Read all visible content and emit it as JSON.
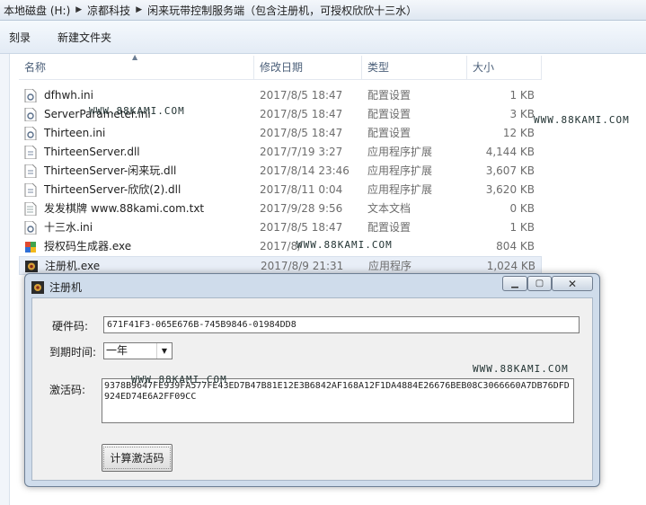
{
  "address_bar": {
    "crumbs": [
      "本地磁盘 (H:)",
      "凉都科技",
      "闲来玩带控制服务端（包含注册机，可授权欣欣十三水）"
    ]
  },
  "toolbar": {
    "burn_label": "刻录",
    "new_folder_label": "新建文件夹"
  },
  "columns": {
    "name": "名称",
    "date": "修改日期",
    "type": "类型",
    "size": "大小"
  },
  "files": [
    {
      "name": "dfhwh.ini",
      "date": "2017/8/5 18:47",
      "type": "配置设置",
      "size": "1 KB",
      "icon": "ini-file-icon"
    },
    {
      "name": "ServerParameter.ini",
      "date": "2017/8/5 18:47",
      "type": "配置设置",
      "size": "3 KB",
      "icon": "ini-file-icon"
    },
    {
      "name": "Thirteen.ini",
      "date": "2017/8/5 18:47",
      "type": "配置设置",
      "size": "12 KB",
      "icon": "ini-file-icon"
    },
    {
      "name": "ThirteenServer.dll",
      "date": "2017/7/19 3:27",
      "type": "应用程序扩展",
      "size": "4,144 KB",
      "icon": "dll-file-icon"
    },
    {
      "name": "ThirteenServer-闲来玩.dll",
      "date": "2017/8/14 23:46",
      "type": "应用程序扩展",
      "size": "3,607 KB",
      "icon": "dll-file-icon"
    },
    {
      "name": "ThirteenServer-欣欣(2).dll",
      "date": "2017/8/11 0:04",
      "type": "应用程序扩展",
      "size": "3,620 KB",
      "icon": "dll-file-icon"
    },
    {
      "name": "发发棋牌 www.88kami.com.txt",
      "date": "2017/9/28 9:56",
      "type": "文本文档",
      "size": "0 KB",
      "icon": "txt-file-icon"
    },
    {
      "name": "十三水.ini",
      "date": "2017/8/5 18:47",
      "type": "配置设置",
      "size": "1 KB",
      "icon": "ini-file-icon"
    },
    {
      "name": "授权码生成器.exe",
      "date": "2017/8/",
      "type": "",
      "size": "804 KB",
      "icon": "generator-exe-icon"
    },
    {
      "name": "注册机.exe",
      "date": "2017/8/9 21:31",
      "type": "应用程序",
      "size": "1,024 KB",
      "icon": "app-exe-icon"
    }
  ],
  "watermarks": [
    "WWW.88KAMI.COM",
    "WWW.88KAMI.COM",
    "WWW.88KAMI.COM",
    "WWW.88KAMI.COM",
    "WWW.88KAMI.COM"
  ],
  "dialog": {
    "title": "注册机",
    "hardware_code_label": "硬件码:",
    "hardware_code_value": "671F41F3-065E676B-745B9846-01984DD8",
    "expiry_label": "到期时间:",
    "expiry_value": "一年",
    "activation_label": "激活码:",
    "activation_value": "9378B9647FE939FA577FE43ED7B47B81E12E3B6842AF168A12F1DA4884E26676BEB08C3066660A7DB76DFD924ED74E6A2FF09CC",
    "calc_button_label": "计算激活码"
  },
  "colors": {
    "selection": "#e8eef7",
    "dialog_frame": "#cfdceb"
  }
}
